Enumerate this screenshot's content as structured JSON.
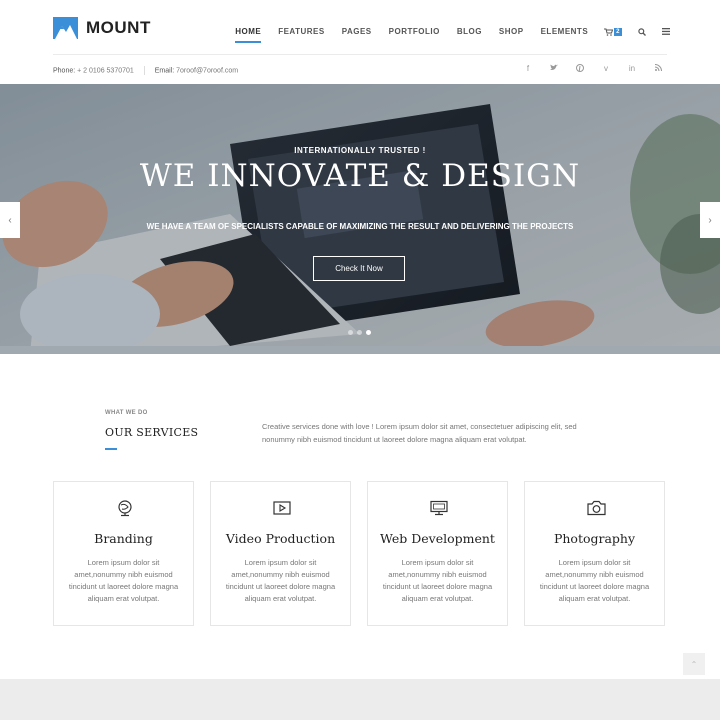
{
  "brand": {
    "name": "MOUNT",
    "accent": "#3b8ed8"
  },
  "nav": {
    "items": [
      "HOME",
      "FEATURES",
      "PAGES",
      "PORTFOLIO",
      "BLOG",
      "SHOP",
      "ELEMENTS"
    ],
    "cart_count": "2"
  },
  "contact": {
    "phone_label": "Phone:",
    "phone": "+ 2 0106 5370701",
    "email_label": "Email:",
    "email": "7oroof@7oroof.com"
  },
  "socials": [
    "facebook-icon",
    "twitter-icon",
    "pinterest-icon",
    "vimeo-icon",
    "linkedin-icon",
    "rss-icon"
  ],
  "hero": {
    "kicker": "INTERNATIONALLY TRUSTED !",
    "title": "WE INNOVATE & DESIGN",
    "subtitle": "WE HAVE A TEAM OF SPECIALISTS CAPABLE OF MAXIMIZING THE RESULT AND DELIVERING THE PROJECTS",
    "button": "Check It Now",
    "active_slide": 3,
    "slide_count": 3
  },
  "services": {
    "kicker": "WHAT WE DO",
    "title": "OUR SERVICES",
    "intro": "Creative services done with love ! Lorem ipsum dolor sit amet, consectetuer adipiscing elit, sed nonummy nibh euismod tincidunt ut laoreet dolore magna aliquam erat volutpat.",
    "cards": [
      {
        "icon": "globe-pen-icon",
        "title": "Branding",
        "text": "Lorem ipsum dolor sit amet,nonummy nibh euismod tincidunt ut laoreet dolore magna aliquam erat volutpat."
      },
      {
        "icon": "video-play-icon",
        "title": "Video Production",
        "text": "Lorem ipsum dolor sit amet,nonummy nibh euismod tincidunt ut laoreet dolore magna aliquam erat volutpat."
      },
      {
        "icon": "monitor-icon",
        "title": "Web Development",
        "text": "Lorem ipsum dolor sit amet,nonummy nibh euismod tincidunt ut laoreet dolore magna aliquam erat volutpat."
      },
      {
        "icon": "camera-icon",
        "title": "Photography",
        "text": "Lorem ipsum dolor sit amet,nonummy nibh euismod tincidunt ut laoreet dolore magna aliquam erat volutpat."
      }
    ]
  }
}
